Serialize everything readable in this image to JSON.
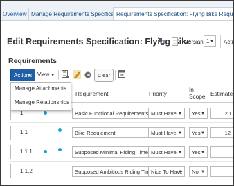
{
  "tabs": {
    "overview": "Overview",
    "manage": "Manage Requirements Specifications",
    "manage_close": "x",
    "spec": "Requirements Specification: Flying Bike Requirements"
  },
  "header": {
    "title": "Edit Requirements Specification: Flying Bike ...",
    "version_label": "Version",
    "version_value": "1",
    "actions_truncated": "Acti"
  },
  "section_title": "Requirements",
  "toolbar": {
    "actions_label": "Actions",
    "view_label": "View",
    "clear_label": "Clear"
  },
  "actions_menu": [
    "Manage Attachments",
    "Manage Relationships"
  ],
  "columns": {
    "requirement": "Requirement",
    "priority": "Priority",
    "in_scope_line1": "In",
    "in_scope_line2": "Scope",
    "estimate": "Estimate"
  },
  "rows": [
    {
      "number": "1",
      "dots": 1,
      "requirement": "Basic Functional Requirements",
      "priority": "Must Have",
      "in_scope": "Yes",
      "estimate": "20"
    },
    {
      "number": "1.1",
      "dots": 1,
      "requirement": "Bike Requiement",
      "priority": "Must Have",
      "in_scope": "Yes",
      "estimate": "12"
    },
    {
      "number": "1.1.1",
      "dots": 2,
      "requirement": "Supposed Minimal Riding Time:",
      "priority": "Must Have",
      "in_scope": "Yes",
      "estimate": ""
    },
    {
      "number": "1.1.2",
      "dots": 0,
      "requirement": "Supposed Ambitious Riding Time:",
      "priority": "Nice To Have",
      "in_scope": "No",
      "estimate": ""
    }
  ],
  "colors": {
    "accent": "#1f5fa6",
    "dot": "#1a9fd9",
    "tabbar": "#eef2f6"
  },
  "icons": [
    "compare-icon",
    "document-icon",
    "column-settings-icon",
    "edit-pencil-icon",
    "go-arrow-icon",
    "detach-icon"
  ]
}
